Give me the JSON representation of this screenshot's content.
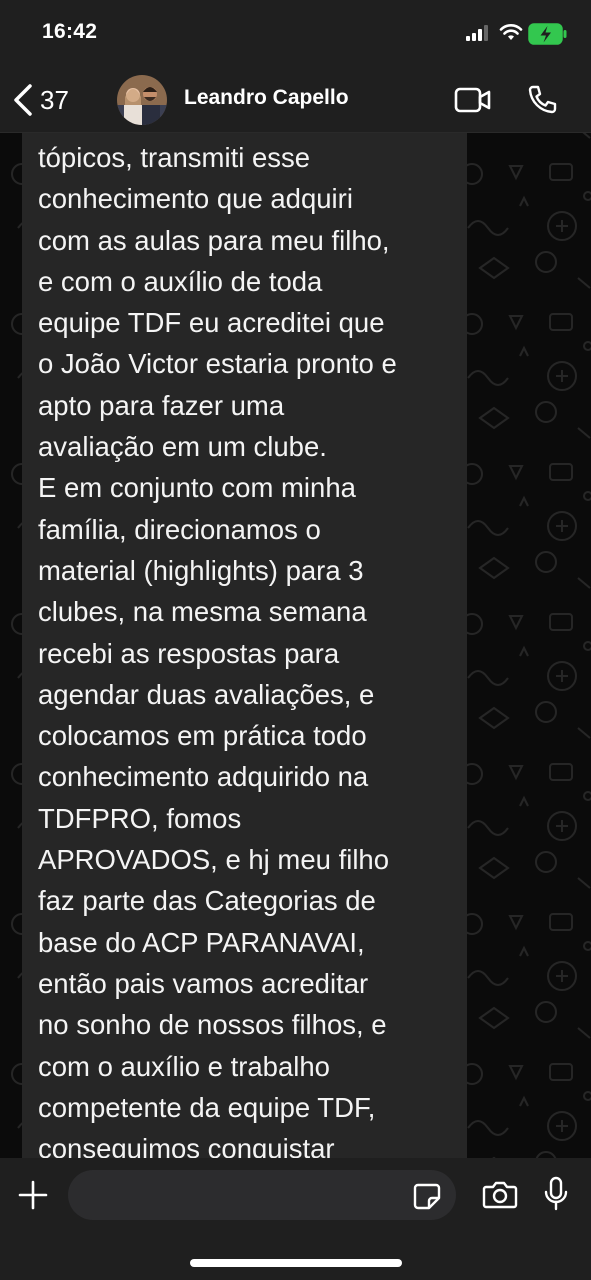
{
  "status_bar": {
    "time": "16:42",
    "icons": [
      "signal-icon",
      "wifi-icon",
      "battery-charging-icon"
    ]
  },
  "header": {
    "back_count": "37",
    "contact_name": "Leandro Capello",
    "icons": [
      "chevron-left-icon",
      "video-camera-icon",
      "phone-icon"
    ]
  },
  "message": {
    "lines": [
      "tópicos, transmiti esse",
      "conhecimento que adquiri",
      "com as aulas para meu filho,",
      "e com o auxílio de toda",
      "equipe TDF eu acreditei que",
      "o João Victor estaria pronto e",
      "apto para fazer uma",
      "avaliação em um clube.",
      "E em conjunto com minha",
      "família, direcionamos o",
      "material (highlights) para 3",
      "clubes, na mesma semana",
      "recebi as respostas para",
      "agendar duas avaliações, e",
      "colocamos em prática todo",
      "conhecimento adquirido na",
      "TDFPRO, fomos",
      "APROVADOS, e hj meu filho",
      "faz parte das Categorias de",
      "base do ACP PARANAVAI,",
      "então pais vamos acreditar",
      "no sonho de nossos filhos, e",
      "com o auxílio e trabalho",
      "competente da equipe TDF,",
      "conseguimos conquistar"
    ]
  },
  "input_bar": {
    "value": "",
    "icons": [
      "plus-icon",
      "sticker-icon",
      "camera-icon",
      "microphone-icon"
    ]
  },
  "colors": {
    "bars": "#1f1f1f",
    "bubble": "#262626",
    "background": "#0b0b0b",
    "battery_charging": "#33c74f"
  }
}
